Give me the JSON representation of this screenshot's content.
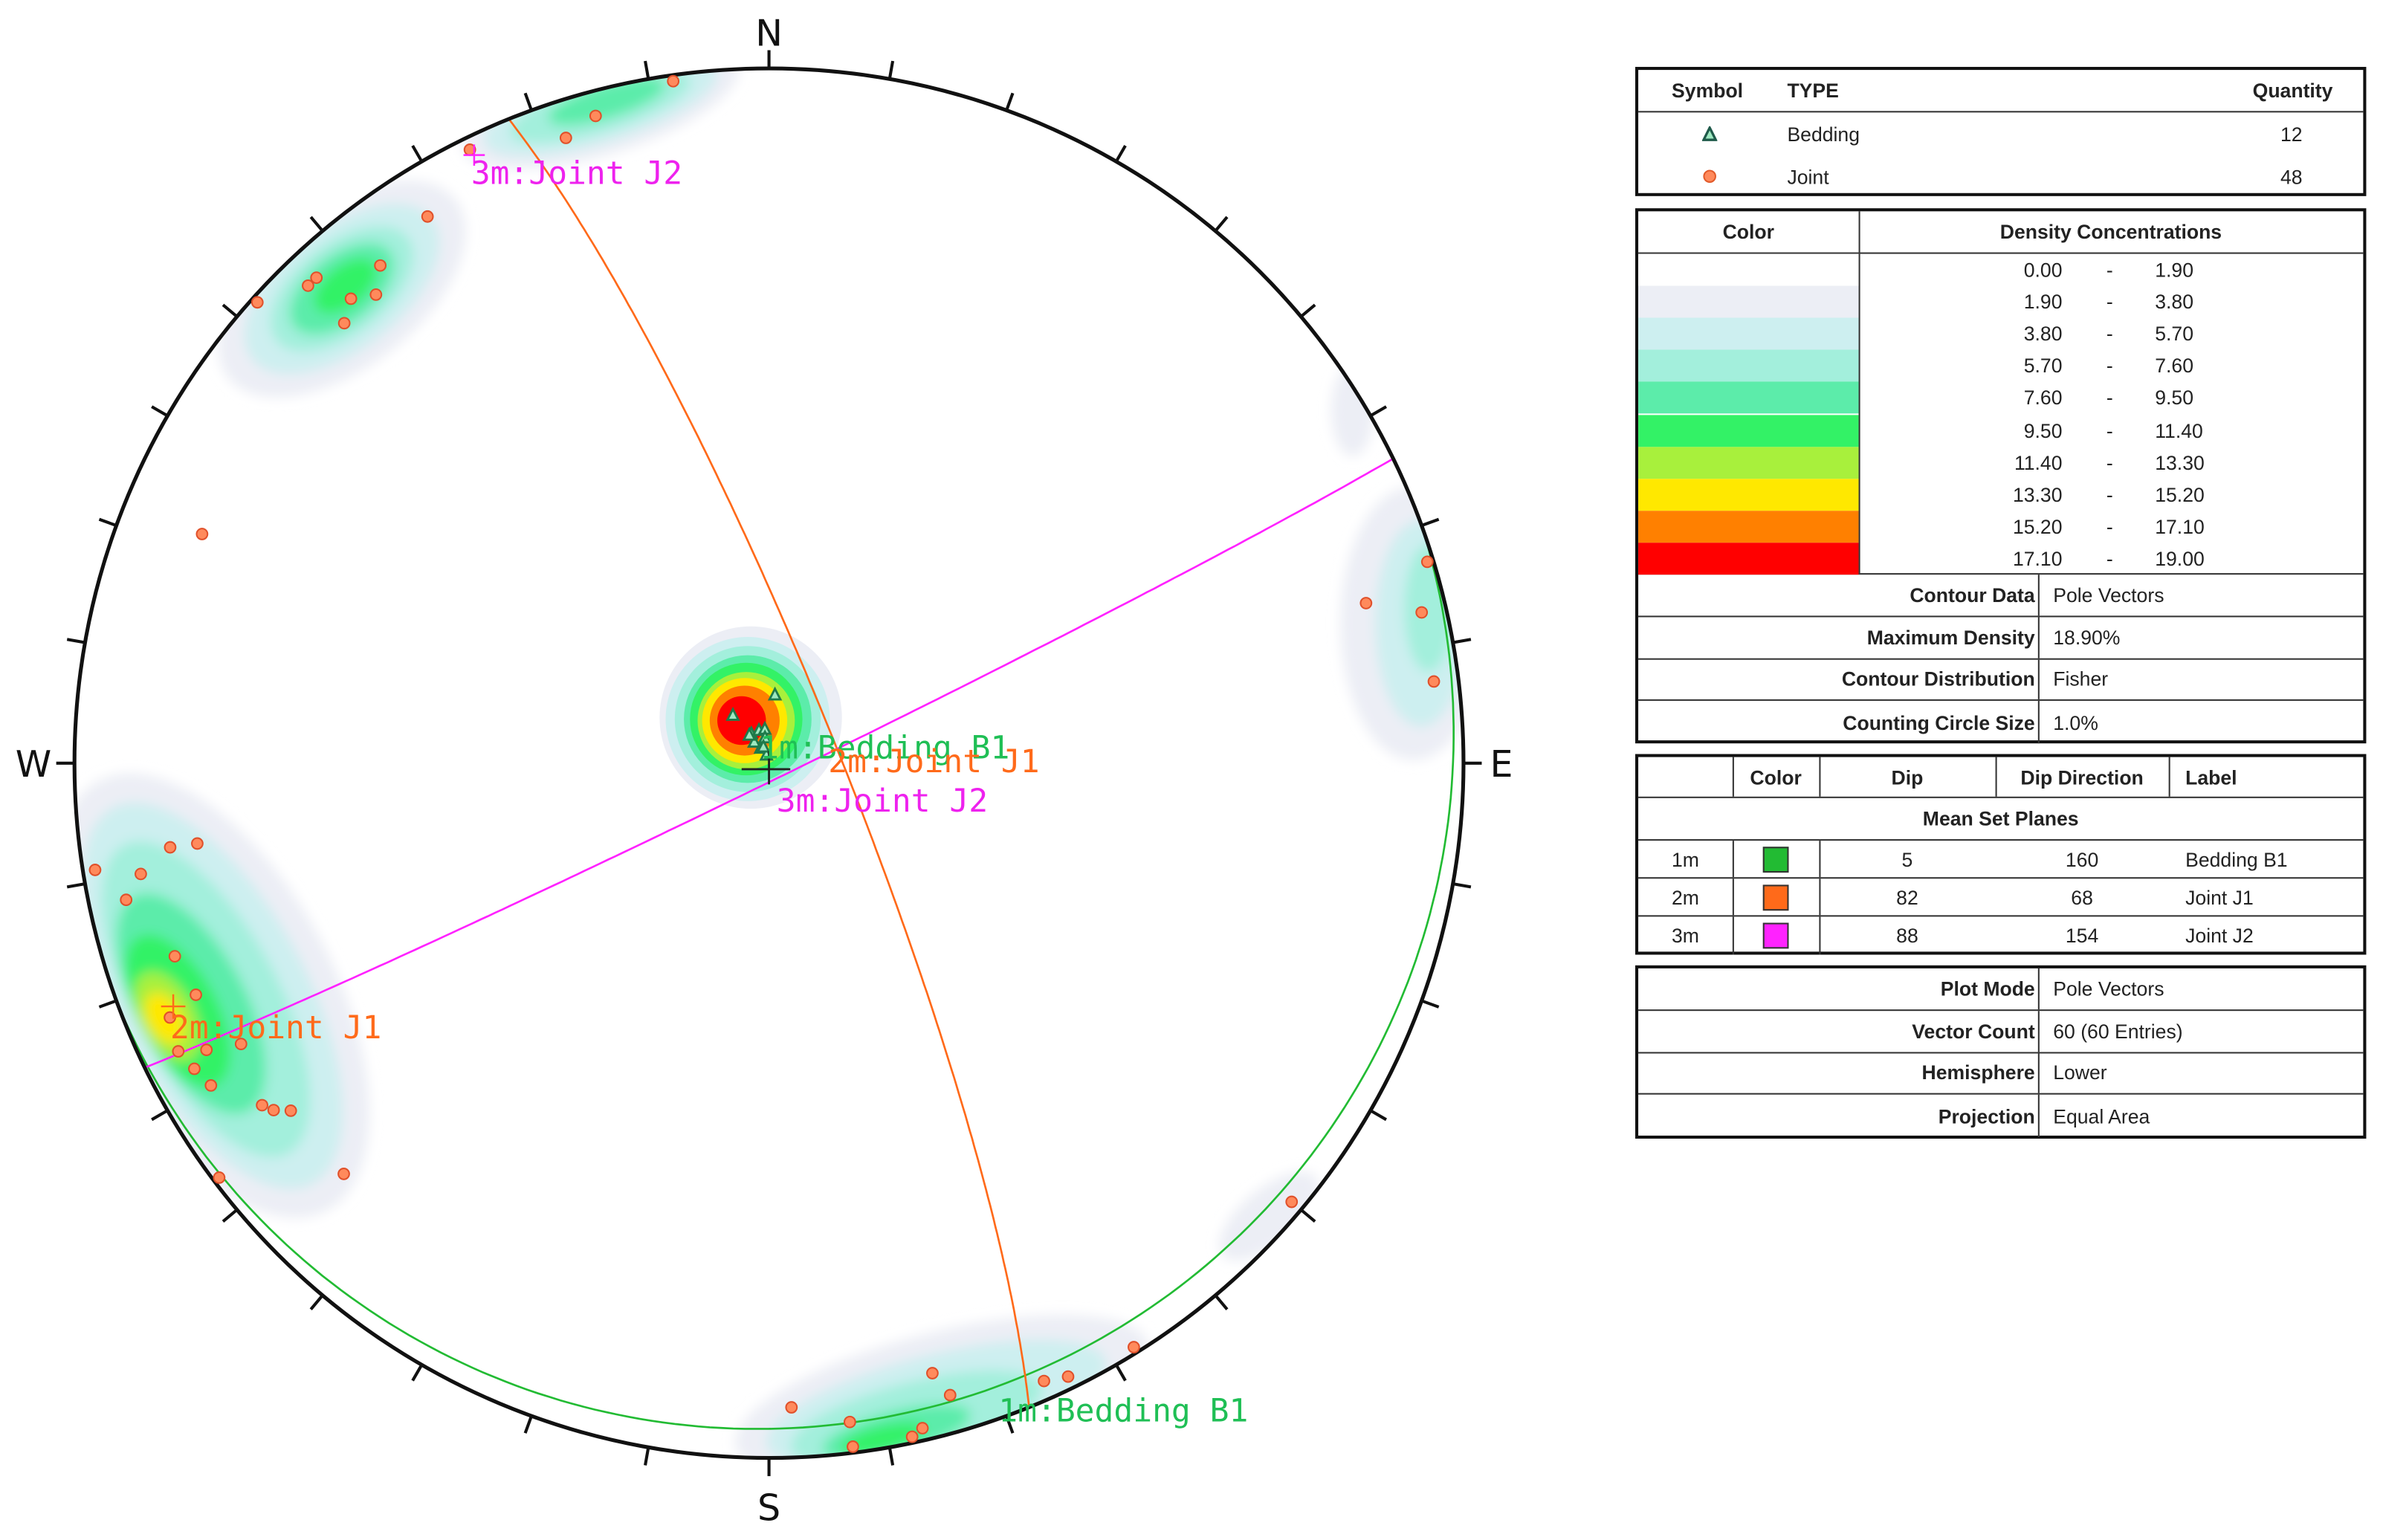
{
  "stereonet": {
    "directions": {
      "n": "N",
      "e": "E",
      "s": "S",
      "w": "W"
    },
    "tick_interval_deg": 10,
    "projection": "equal-area",
    "hemisphere": "lower",
    "bedding_color": "#1f7a4a",
    "joint_color": "#ff7043",
    "poles": {
      "bedding": [
        [
          323,
          83
        ],
        [
          329,
          86
        ],
        [
          343,
          86
        ],
        [
          353,
          86
        ],
        [
          5,
          82
        ],
        [
          325,
          87
        ],
        [
          331,
          88
        ],
        [
          333,
          88
        ],
        [
          343,
          89
        ],
        [
          325,
          86
        ],
        [
          351,
          87
        ],
        [
          341,
          88
        ]
      ],
      "joint": [
        [
          352,
          1
        ],
        [
          345,
          4
        ],
        [
          342,
          6
        ],
        [
          334,
          2
        ],
        [
          328,
          8
        ],
        [
          322,
          10
        ],
        [
          317,
          5
        ],
        [
          316,
          5
        ],
        [
          318,
          11
        ],
        [
          320,
          13
        ],
        [
          316,
          13
        ],
        [
          312,
          1
        ],
        [
          292,
          13
        ],
        [
          262,
          18
        ],
        [
          262,
          14
        ],
        [
          260,
          9
        ],
        [
          261,
          2
        ],
        [
          258,
          6
        ],
        [
          252,
          11
        ],
        [
          248,
          12
        ],
        [
          247,
          7
        ],
        [
          244,
          6
        ],
        [
          243,
          10
        ],
        [
          242,
          15
        ],
        [
          242,
          7
        ],
        [
          240,
          8
        ],
        [
          236,
          13
        ],
        [
          235,
          14
        ],
        [
          234,
          16
        ],
        [
          233,
          1
        ],
        [
          226,
          16
        ],
        [
          73,
          1
        ],
        [
          75,
          12
        ],
        [
          77,
          4
        ],
        [
          83,
          4
        ],
        [
          130,
          2
        ],
        [
          148,
          1
        ],
        [
          154,
          2
        ],
        [
          156,
          3
        ],
        [
          164,
          6
        ],
        [
          165,
          10
        ],
        [
          178,
          8
        ],
        [
          173,
          5
        ],
        [
          167,
          2
        ],
        [
          168,
          1
        ],
        [
          173,
          1
        ]
      ]
    },
    "labels": {
      "b1_center": "1m:Bedding B1",
      "j1_center": "2m:Joint J1",
      "j2_center": "3m:Joint J2",
      "j2_pole": "3m:Joint J2",
      "j1_pole": "2m:Joint J1",
      "b1_circle": "1m:Bedding B1"
    }
  },
  "legend": {
    "symbols": {
      "headers": {
        "symbol": "Symbol",
        "type": "TYPE",
        "quantity": "Quantity"
      },
      "rows": [
        {
          "type": "Bedding",
          "quantity": "12"
        },
        {
          "type": "Joint",
          "quantity": "48"
        }
      ]
    },
    "density": {
      "headers": {
        "color": "Color",
        "range": "Density Concentrations"
      },
      "sep": "-",
      "bins": [
        {
          "from": "0.00",
          "to": "1.90",
          "color": "#ffffff"
        },
        {
          "from": "1.90",
          "to": "3.80",
          "color": "#eceef5"
        },
        {
          "from": "3.80",
          "to": "5.70",
          "color": "#cdeff0"
        },
        {
          "from": "5.70",
          "to": "7.60",
          "color": "#a3efdc"
        },
        {
          "from": "7.60",
          "to": "9.50",
          "color": "#5cecaa"
        },
        {
          "from": "9.50",
          "to": "11.40",
          "color": "#33f266"
        },
        {
          "from": "11.40",
          "to": "13.30",
          "color": "#a8f03c"
        },
        {
          "from": "13.30",
          "to": "15.20",
          "color": "#ffe800"
        },
        {
          "from": "15.20",
          "to": "17.10",
          "color": "#ff8000"
        },
        {
          "from": "17.10",
          "to": "19.00",
          "color": "#ff0000"
        }
      ],
      "props": [
        {
          "k": "Contour Data",
          "v": "Pole Vectors"
        },
        {
          "k": "Maximum Density",
          "v": "18.90%"
        },
        {
          "k": "Contour Distribution",
          "v": "Fisher"
        },
        {
          "k": "Counting Circle Size",
          "v": "1.0%"
        }
      ]
    },
    "sets": {
      "headers": {
        "color": "Color",
        "dip": "Dip",
        "dipdir": "Dip Direction",
        "label": "Label"
      },
      "title": "Mean Set Planes",
      "rows": [
        {
          "id": "1m",
          "color": "#22bb33",
          "dip": "5",
          "dipdir": "160",
          "label": "Bedding B1"
        },
        {
          "id": "2m",
          "color": "#ff6a1a",
          "dip": "82",
          "dipdir": "68",
          "label": "Joint J1"
        },
        {
          "id": "3m",
          "color": "#ff22ff",
          "dip": "88",
          "dipdir": "154",
          "label": "Joint J2"
        }
      ]
    },
    "plot": [
      {
        "k": "Plot Mode",
        "v": "Pole Vectors"
      },
      {
        "k": "Vector Count",
        "v": "60 (60 Entries)"
      },
      {
        "k": "Hemisphere",
        "v": "Lower"
      },
      {
        "k": "Projection",
        "v": "Equal Area"
      }
    ]
  }
}
